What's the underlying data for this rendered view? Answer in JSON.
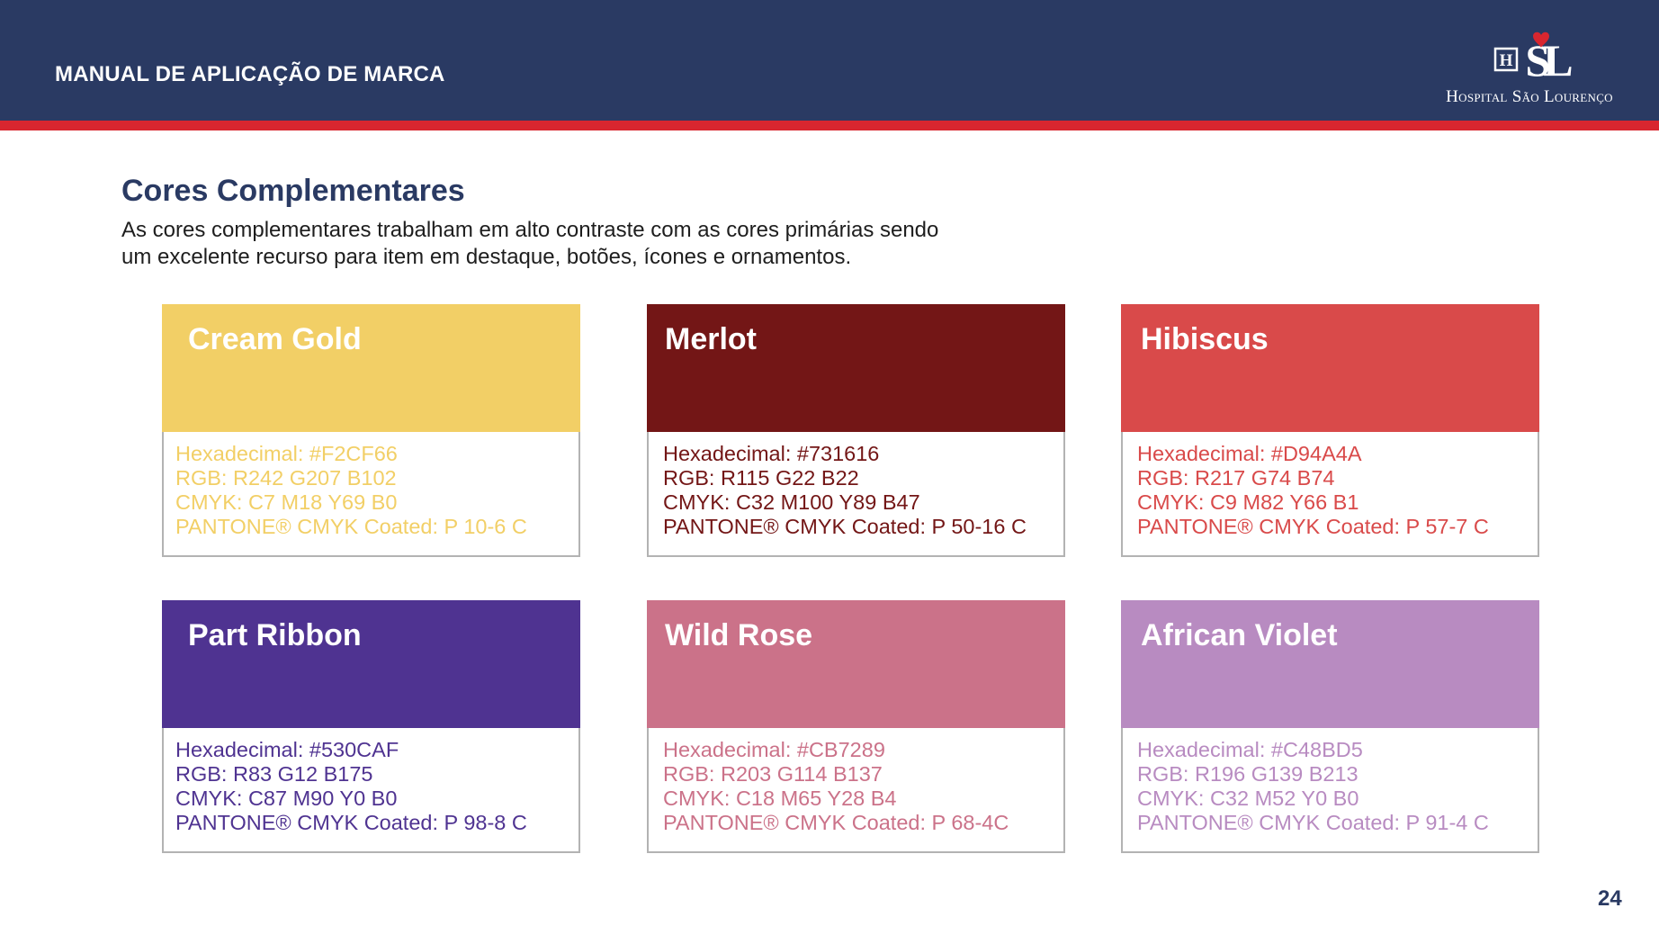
{
  "header": {
    "title": "MANUAL DE APLICAÇÃO DE MARCA",
    "logo_text": "Hospital São Lourenço",
    "logo_letters": "H",
    "logo_monogram": "SL",
    "background_color": "#2a3a63",
    "stripe_color": "#d8262f"
  },
  "section": {
    "title": "Cores Complementares",
    "description_line1": "As cores complementares trabalham em alto contraste com as cores primárias sendo",
    "description_line2": "um excelente recurso para item em destaque, botões, ícones e ornamentos."
  },
  "colors": [
    {
      "name": "Cream Gold",
      "swatch": "#F2CF66",
      "hex": "Hexadecimal: #F2CF66",
      "rgb": "RGB: R242 G207 B102",
      "cmyk": "CMYK:  C7 M18 Y69 B0",
      "pantone": "PANTONE® CMYK Coated: P 10-6 C"
    },
    {
      "name": "Merlot",
      "swatch": "#731616",
      "hex": "Hexadecimal: #731616",
      "rgb": "RGB: R115 G22 B22",
      "cmyk": "CMYK:  C32 M100 Y89 B47",
      "pantone": "PANTONE® CMYK Coated: P 50-16 C"
    },
    {
      "name": "Hibiscus",
      "swatch": "#D94A4A",
      "hex": "Hexadecimal: #D94A4A",
      "rgb": "RGB: R217 G74 B74",
      "cmyk": "CMYK:  C9 M82 Y66 B1",
      "pantone": "PANTONE® CMYK Coated: P 57-7 C"
    },
    {
      "name": "Part Ribbon",
      "swatch": "#530CAF",
      "display_color": "#4f3391",
      "hex": "Hexadecimal: #530CAF",
      "rgb": "RGB: R83 G12 B175",
      "cmyk": "CMYK:  C87 M90 Y0 B0",
      "pantone": "PANTONE® CMYK Coated: P 98-8 C"
    },
    {
      "name": "Wild Rose",
      "swatch": "#CB7289",
      "hex": "Hexadecimal: #CB7289",
      "rgb": "RGB: R203 G114 B137",
      "cmyk": "CMYK:  C18 M65 Y28 B4",
      "pantone": "PANTONE® CMYK Coated: P 68-4C"
    },
    {
      "name": "African Violet",
      "swatch": "#C48BD5",
      "display_color": "#b88bc1",
      "hex": "Hexadecimal: #C48BD5",
      "rgb": "RGB: R196 G139 B213",
      "cmyk": "CMYK:  C32 M52 Y0 B0",
      "pantone": "PANTONE® CMYK Coated: P 91-4 C"
    }
  ],
  "page_number": "24"
}
